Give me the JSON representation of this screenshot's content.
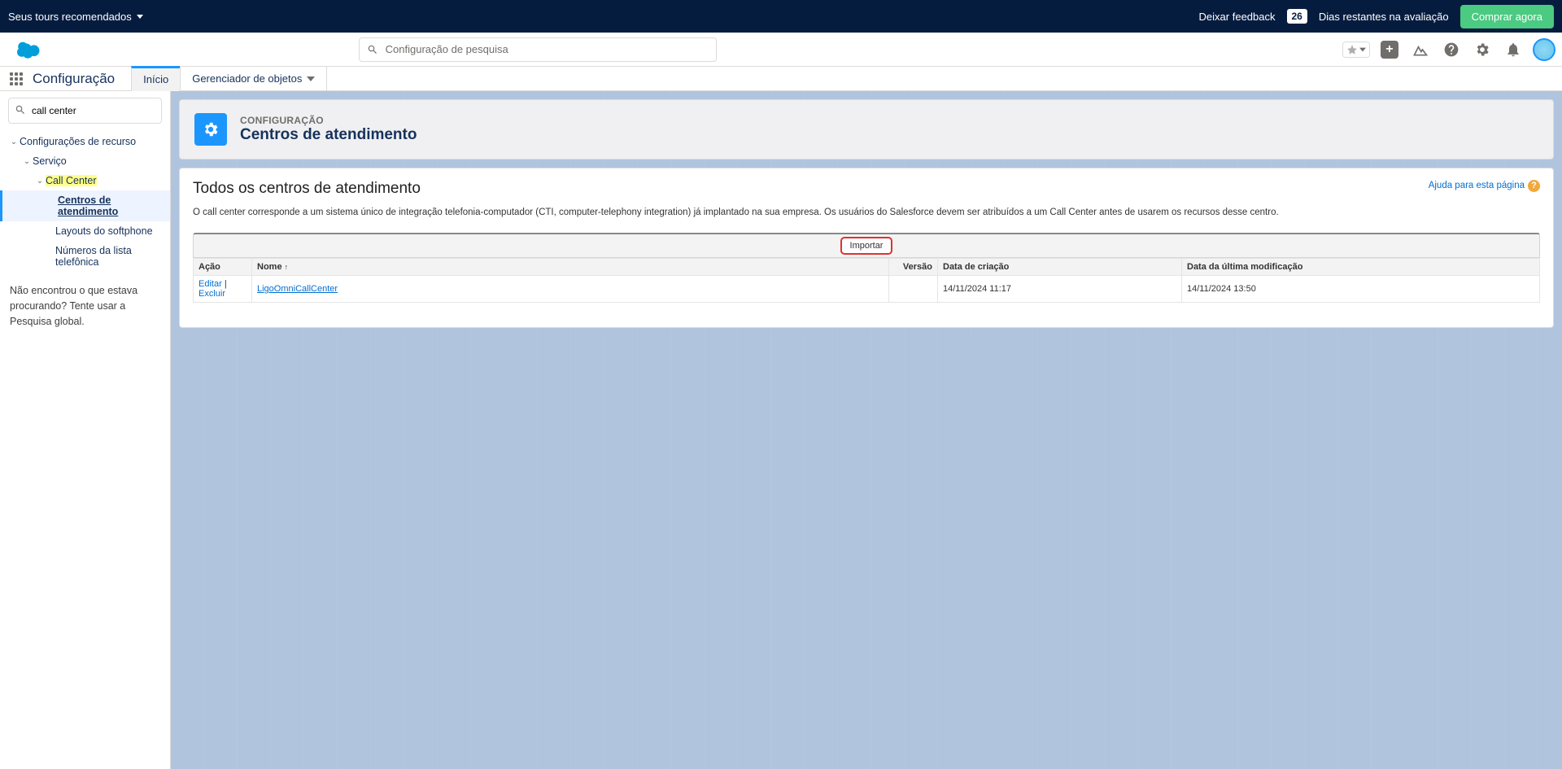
{
  "trial": {
    "tours_label": "Seus tours recomendados",
    "feedback": "Deixar feedback",
    "days_badge": "26",
    "days_text": "Dias restantes na avaliação",
    "buy": "Comprar agora"
  },
  "header": {
    "search_placeholder": "Configuração de pesquisa"
  },
  "nav": {
    "app_title": "Configuração",
    "tab_home": "Início",
    "tab_object_manager": "Gerenciador de objetos"
  },
  "sidebar": {
    "quick_find_value": "call center",
    "group": "Configurações de recurso",
    "service": "Serviço",
    "callcenter": "Call Center",
    "leaf_callcenters": "Centros de atendimento",
    "leaf_softphone": "Layouts do softphone",
    "leaf_numbers": "Números da lista telefônica",
    "not_found": "Não encontrou o que estava procurando? Tente usar a Pesquisa global."
  },
  "page": {
    "eyebrow": "CONFIGURAÇÃO",
    "title": "Centros de atendimento"
  },
  "card": {
    "title": "Todos os centros de atendimento",
    "help": "Ajuda para esta página",
    "desc": "O call center corresponde a um sistema único de integração telefonia-computador (CTI, computer-telephony integration) já implantado na sua empresa. Os usuários do Salesforce devem ser atribuídos a um Call Center antes de usarem os recursos desse centro.",
    "import": "Importar"
  },
  "table": {
    "col_action": "Ação",
    "col_name": "Nome",
    "col_version": "Versão",
    "col_created": "Data de criação",
    "col_modified": "Data da última modificação",
    "rows": [
      {
        "edit": "Editar",
        "del": "Excluir",
        "name": "LigoOmniCallCenter",
        "version": "",
        "created": "14/11/2024 11:17",
        "modified": "14/11/2024 13:50"
      }
    ]
  }
}
